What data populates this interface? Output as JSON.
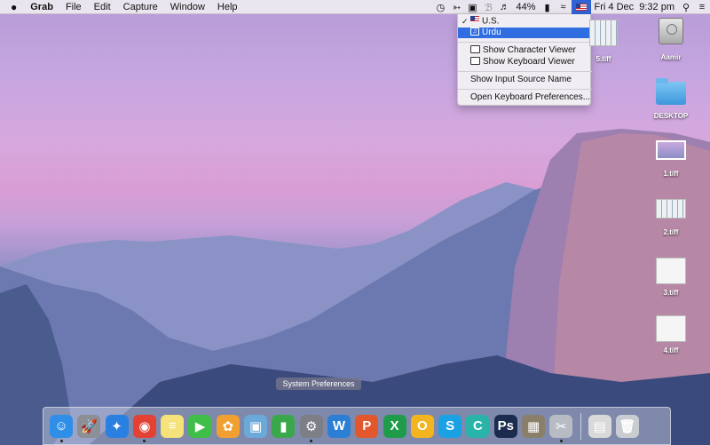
{
  "menubar": {
    "apple_icon": "apple-icon",
    "app_name": "Grab",
    "menus": [
      "File",
      "Edit",
      "Capture",
      "Window",
      "Help"
    ],
    "battery": "44%",
    "clock": "Fri 4 Dec  9:32 pm",
    "status_icons": [
      "time-machine-icon",
      "app-status-icon",
      "airplay-icon",
      "bluetooth-icon",
      "volume-icon",
      "battery-icon",
      "wifi-icon",
      "input-source-flag-icon",
      "spotlight-icon",
      "notification-center-icon"
    ]
  },
  "input_menu": {
    "items": [
      {
        "label": "U.S.",
        "checked": true,
        "icon": "us-flag-icon"
      },
      {
        "label": "Urdu",
        "selected": true,
        "icon": "urdu-keyboard-icon"
      }
    ],
    "viewer_items": [
      {
        "label": "Show Character Viewer",
        "icon": "character-viewer-icon"
      },
      {
        "label": "Show Keyboard Viewer",
        "icon": "keyboard-viewer-icon"
      }
    ],
    "show_name": "Show Input Source Name",
    "open_prefs": "Open Keyboard Preferences..."
  },
  "desktop": {
    "icons": [
      {
        "label": "Aamir",
        "icon": "hard-drive-icon"
      },
      {
        "label": "DESKTOP",
        "icon": "folder-icon"
      },
      {
        "label": "1.tiff",
        "icon": "image-file-icon"
      },
      {
        "label": "2.tiff",
        "icon": "image-file-icon"
      },
      {
        "label": "3.tiff",
        "icon": "image-file-icon"
      },
      {
        "label": "4.tiff",
        "icon": "image-file-icon"
      },
      {
        "label": "5.tiff",
        "icon": "image-file-icon"
      }
    ]
  },
  "tooltip": "System Preferences",
  "dock": {
    "apps": [
      {
        "name": "finder",
        "glyph": "☺",
        "color": "#2f8fe8",
        "running": true
      },
      {
        "name": "launchpad",
        "glyph": "🚀",
        "color": "#8c8f96",
        "running": false
      },
      {
        "name": "safari",
        "glyph": "✦",
        "color": "#2a80e0",
        "running": false
      },
      {
        "name": "chrome",
        "glyph": "◉",
        "color": "#e34133",
        "running": true
      },
      {
        "name": "notes",
        "glyph": "≡",
        "color": "#f6e27a",
        "running": false
      },
      {
        "name": "facetime",
        "glyph": "▶",
        "color": "#3fbf4a",
        "running": false
      },
      {
        "name": "photos",
        "glyph": "✿",
        "color": "#f0a030",
        "running": false
      },
      {
        "name": "preview",
        "glyph": "▣",
        "color": "#6aa9d8",
        "running": false
      },
      {
        "name": "numbers",
        "glyph": "▮",
        "color": "#3aa84a",
        "running": false
      },
      {
        "name": "system-preferences",
        "glyph": "⚙",
        "color": "#7c7f86",
        "running": true
      },
      {
        "name": "word",
        "glyph": "W",
        "color": "#2b7fd4",
        "running": false
      },
      {
        "name": "powerpoint",
        "glyph": "P",
        "color": "#e2572c",
        "running": false
      },
      {
        "name": "excel",
        "glyph": "X",
        "color": "#1f9c4a",
        "running": false
      },
      {
        "name": "outlook",
        "glyph": "O",
        "color": "#f2b51f",
        "running": false
      },
      {
        "name": "skype",
        "glyph": "S",
        "color": "#1aa1e4",
        "running": false
      },
      {
        "name": "camtasia",
        "glyph": "C",
        "color": "#2ab3a8",
        "running": false
      },
      {
        "name": "photoshop",
        "glyph": "Ps",
        "color": "#1b2c4f",
        "running": false
      },
      {
        "name": "calculator",
        "glyph": "▦",
        "color": "#8a7f6a",
        "running": false
      },
      {
        "name": "grab",
        "glyph": "✂",
        "color": "#b7bcc4",
        "running": true
      }
    ],
    "trash": [
      {
        "name": "downloads",
        "glyph": "▤",
        "color": "#d9d9d9"
      },
      {
        "name": "trash",
        "glyph": "🗑",
        "color": "#c9ccd1"
      }
    ]
  }
}
